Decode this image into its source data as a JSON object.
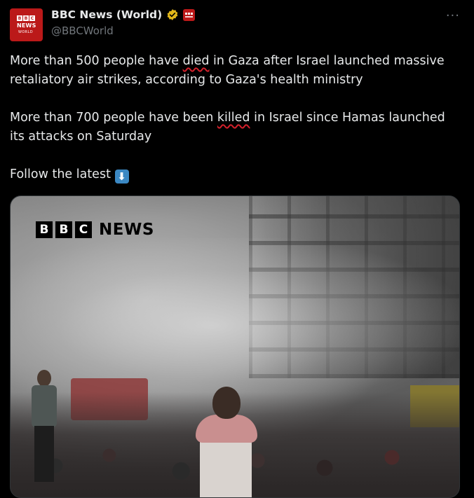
{
  "author": {
    "display_name": "BBC News (World)",
    "handle": "@BBCWorld",
    "avatar": {
      "line1": [
        "B",
        "B",
        "C"
      ],
      "line2": "NEWS",
      "line3": "WORLD"
    },
    "verified_icon": "verified-badge-icon",
    "affiliation_icon": "bbc-affiliation-icon"
  },
  "more_label": "···",
  "tweet": {
    "para1": {
      "pre": "More than 500 people have ",
      "marked": "died",
      "post": " in Gaza after Israel launched massive retaliatory air strikes, according to Gaza's health ministry"
    },
    "para2": {
      "pre": "More than 700 people have been ",
      "marked": "killed",
      "post": " in Israel since Hamas launched its attacks on Saturday"
    },
    "para3": {
      "text": "Follow the latest ",
      "emoji": "⬇"
    }
  },
  "media": {
    "logo_letters": [
      "B",
      "B",
      "C"
    ],
    "logo_word": "NEWS"
  },
  "colors": {
    "background": "#000000",
    "text": "#e7e9ea",
    "muted": "#71767b",
    "bbc_red": "#bb1919",
    "verified_gold": "#e2b719"
  }
}
